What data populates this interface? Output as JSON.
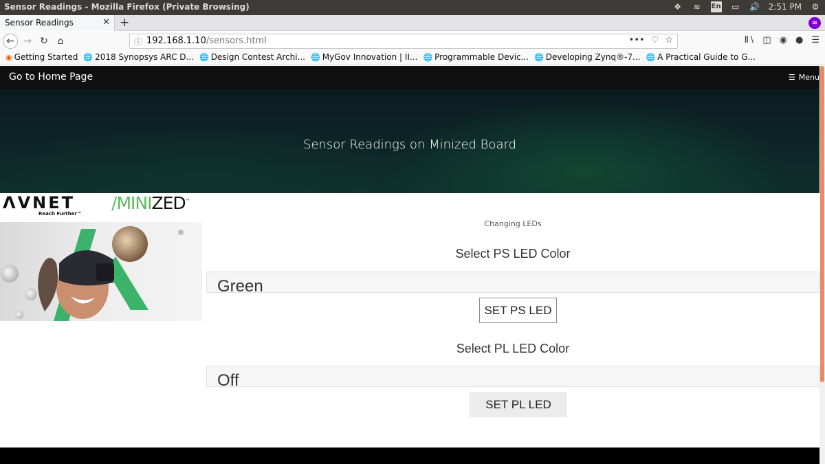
{
  "os": {
    "window_title": "Sensor Readings - Mozilla Firefox (Private Browsing)",
    "keyboard_lang": "En",
    "clock": "2:51 PM"
  },
  "browser": {
    "tab_title": "Sensor Readings",
    "url_host": "192.168.1.10",
    "url_path": "/sensors.html",
    "url_actions_more": "•••",
    "bookmarks": [
      {
        "label": "Getting Started",
        "icon": "firefox-icon"
      },
      {
        "label": "2018 Synopsys ARC D...",
        "icon": "globe-icon"
      },
      {
        "label": "Design Contest Archi...",
        "icon": "globe-icon"
      },
      {
        "label": "MyGov Innovation | II...",
        "icon": "globe-icon"
      },
      {
        "label": "Programmable Devic...",
        "icon": "globe-icon"
      },
      {
        "label": "Developing Zynq®-7...",
        "icon": "globe-icon"
      },
      {
        "label": "A Practical Guide to G...",
        "icon": "globe-icon"
      }
    ]
  },
  "site": {
    "home_link": "Go to Home Page",
    "menu_label": "Menu",
    "banner_title": "Sensor Readings on Minized Board",
    "logo_avnet": "ΛVNET",
    "logo_tagline": "Reach Further™",
    "logo_minized_slash": "/",
    "logo_minized_mini": "MINI",
    "logo_minized_zed": "ZED",
    "logo_tm": "™"
  },
  "led_panel": {
    "heading": "Changing LEDs",
    "ps_label": "Select PS LED Color",
    "ps_value": "Green",
    "ps_button": "SET PS LED",
    "pl_label": "Select PL LED Color",
    "pl_value": "Off",
    "pl_button": "SET PL LED"
  },
  "colors": {
    "accent_green": "#5cb85c",
    "header_bg": "#101010",
    "scroll_thumb": "#e98c62"
  }
}
